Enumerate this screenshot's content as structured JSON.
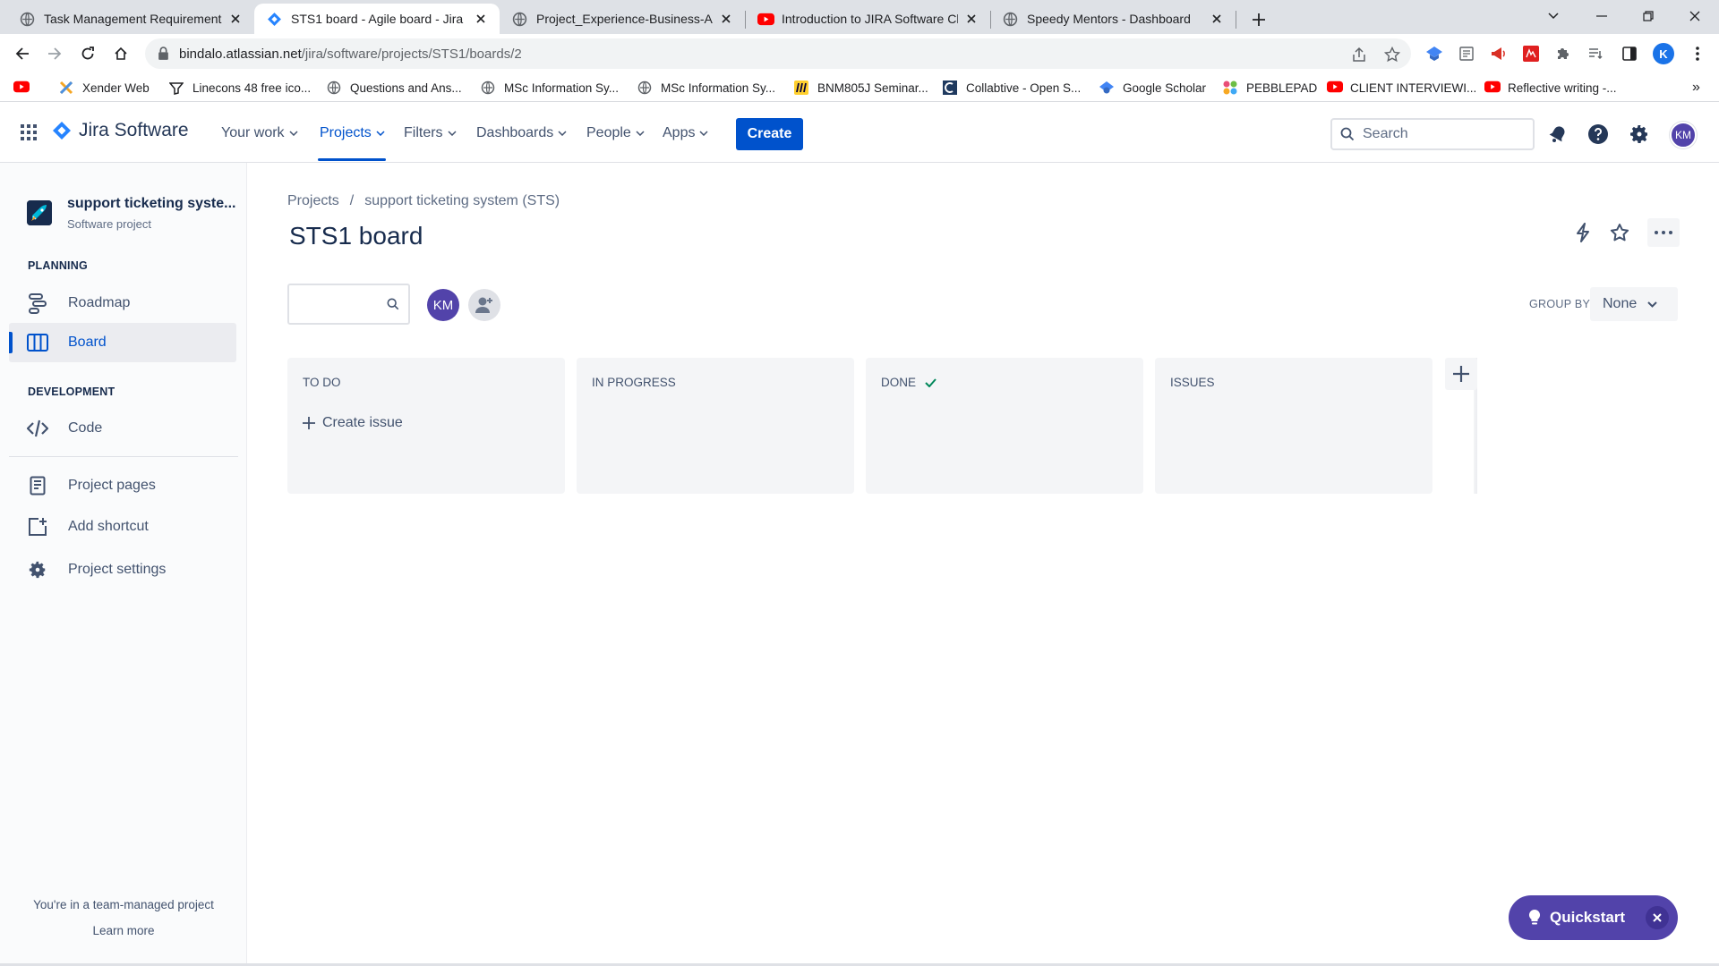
{
  "browser": {
    "tabs": [
      {
        "title": "Task Management Requirement.p",
        "active": false
      },
      {
        "title": "STS1 board - Agile board - Jira",
        "active": true
      },
      {
        "title": "Project_Experience-Business-Ana",
        "active": false
      },
      {
        "title": "Introduction to JIRA Software Cl",
        "active": false
      },
      {
        "title": "Speedy Mentors - Dashboard",
        "active": false
      }
    ],
    "url_host": "bindalo.atlassian.net",
    "url_path": "/jira/software/projects/STS1/boards/2",
    "profile_initial": "K",
    "bookmarks": [
      {
        "label": "",
        "icon": "youtube-icon"
      },
      {
        "label": "Xender Web",
        "icon": "xender-icon"
      },
      {
        "label": "Linecons 48 free ico...",
        "icon": "linecons-icon"
      },
      {
        "label": "Questions and Ans...",
        "icon": "globe-icon"
      },
      {
        "label": "MSc Information Sy...",
        "icon": "globe-icon"
      },
      {
        "label": "MSc Information Sy...",
        "icon": "globe-icon"
      },
      {
        "label": "BNM805J Seminar...",
        "icon": "miro-icon"
      },
      {
        "label": "Collabtive - Open S...",
        "icon": "collabtive-icon"
      },
      {
        "label": "Google Scholar",
        "icon": "scholar-icon"
      },
      {
        "label": "PEBBLEPAD",
        "icon": "pebblepad-icon"
      },
      {
        "label": "CLIENT INTERVIEWI...",
        "icon": "youtube-icon"
      },
      {
        "label": "Reflective writing -...",
        "icon": "youtube-icon"
      }
    ],
    "bookmarks_more": "»"
  },
  "jira": {
    "logo_text": "Jira Software",
    "nav": [
      {
        "label": "Your work"
      },
      {
        "label": "Projects",
        "active": true
      },
      {
        "label": "Filters"
      },
      {
        "label": "Dashboards"
      },
      {
        "label": "People"
      },
      {
        "label": "Apps"
      }
    ],
    "create_label": "Create",
    "search_placeholder": "Search",
    "user_initials": "KM"
  },
  "sidebar": {
    "project_name": "support ticketing syste...",
    "project_type": "Software project",
    "planning_heading": "PLANNING",
    "planning_items": [
      {
        "label": "Roadmap",
        "icon": "roadmap-icon"
      },
      {
        "label": "Board",
        "icon": "board-icon",
        "selected": true
      }
    ],
    "development_heading": "DEVELOPMENT",
    "development_items": [
      {
        "label": "Code",
        "icon": "code-icon"
      }
    ],
    "other_items": [
      {
        "label": "Project pages",
        "icon": "pages-icon"
      },
      {
        "label": "Add shortcut",
        "icon": "add-shortcut-icon"
      },
      {
        "label": "Project settings",
        "icon": "gear-icon"
      }
    ],
    "footer_text": "You're in a team-managed project",
    "footer_link": "Learn more"
  },
  "main": {
    "breadcrumb": [
      "Projects",
      "support ticketing system (STS)"
    ],
    "breadcrumb_sep": "/",
    "title": "STS1 board",
    "filter_avatar": "KM",
    "group_by_label": "GROUP BY",
    "group_by_value": "None",
    "columns": [
      {
        "name": "TO DO",
        "done": false,
        "create_issue": "Create issue"
      },
      {
        "name": "IN PROGRESS",
        "done": false
      },
      {
        "name": "DONE",
        "done": true
      },
      {
        "name": "ISSUES",
        "done": false
      }
    ],
    "quickstart_label": "Quickstart"
  },
  "colors": {
    "brand_blue": "#0052cc",
    "avatar_purple": "#5243aa",
    "text_dark": "#172b4d",
    "text_subtle": "#42526e",
    "column_bg": "#f4f5f7"
  }
}
